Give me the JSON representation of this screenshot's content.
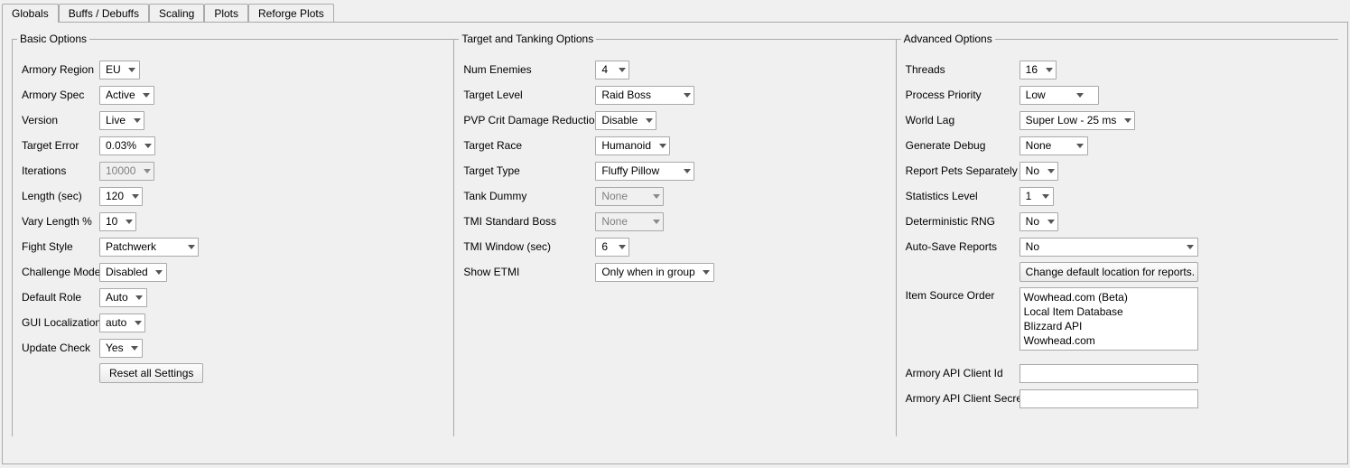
{
  "tabs": {
    "globals": "Globals",
    "buffs": "Buffs / Debuffs",
    "scaling": "Scaling",
    "plots": "Plots",
    "reforge": "Reforge Plots"
  },
  "basic": {
    "legend": "Basic Options",
    "armory_region": {
      "label": "Armory Region",
      "value": "EU"
    },
    "armory_spec": {
      "label": "Armory Spec",
      "value": "Active"
    },
    "version": {
      "label": "Version",
      "value": "Live"
    },
    "target_error": {
      "label": "Target Error",
      "value": "0.03%"
    },
    "iterations": {
      "label": "Iterations",
      "value": "10000"
    },
    "length": {
      "label": "Length (sec)",
      "value": "120"
    },
    "vary_length": {
      "label": "Vary Length %",
      "value": "10"
    },
    "fight_style": {
      "label": "Fight Style",
      "value": "Patchwerk"
    },
    "challenge_mode": {
      "label": "Challenge Mode",
      "value": "Disabled"
    },
    "default_role": {
      "label": "Default Role",
      "value": "Auto"
    },
    "gui_local": {
      "label": "GUI Localization",
      "value": "auto"
    },
    "update_check": {
      "label": "Update Check",
      "value": "Yes"
    },
    "reset_button": "Reset all Settings"
  },
  "target": {
    "legend": "Target and Tanking Options",
    "num_enemies": {
      "label": "Num Enemies",
      "value": "4"
    },
    "target_level": {
      "label": "Target Level",
      "value": "Raid Boss"
    },
    "pvp_crit": {
      "label": "PVP Crit Damage Reduction",
      "value": "Disable"
    },
    "target_race": {
      "label": "Target Race",
      "value": "Humanoid"
    },
    "target_type": {
      "label": "Target Type",
      "value": "Fluffy Pillow"
    },
    "tank_dummy": {
      "label": "Tank Dummy",
      "value": "None"
    },
    "tmi_boss": {
      "label": "TMI Standard Boss",
      "value": "None"
    },
    "tmi_window": {
      "label": "TMI Window (sec)",
      "value": "6"
    },
    "show_etmi": {
      "label": "Show ETMI",
      "value": "Only when in group"
    }
  },
  "advanced": {
    "legend": "Advanced Options",
    "threads": {
      "label": "Threads",
      "value": "16"
    },
    "priority": {
      "label": "Process Priority",
      "value": "Low"
    },
    "world_lag": {
      "label": "World Lag",
      "value": "Super Low - 25 ms"
    },
    "gen_debug": {
      "label": "Generate Debug",
      "value": "None"
    },
    "report_pets": {
      "label": "Report Pets Separately",
      "value": "No"
    },
    "stats_level": {
      "label": "Statistics Level",
      "value": "1"
    },
    "det_rng": {
      "label": "Deterministic RNG",
      "value": "No"
    },
    "autosave": {
      "label": "Auto-Save Reports",
      "value": "No"
    },
    "change_loc_button": "Change default location for reports.",
    "item_source": {
      "label": "Item Source Order",
      "items": [
        "Wowhead.com (Beta)",
        "Local Item Database",
        "Blizzard API",
        "Wowhead.com"
      ]
    },
    "api_id": {
      "label": "Armory API Client Id",
      "value": ""
    },
    "api_secret": {
      "label": "Armory API Client Secret",
      "value": ""
    }
  }
}
